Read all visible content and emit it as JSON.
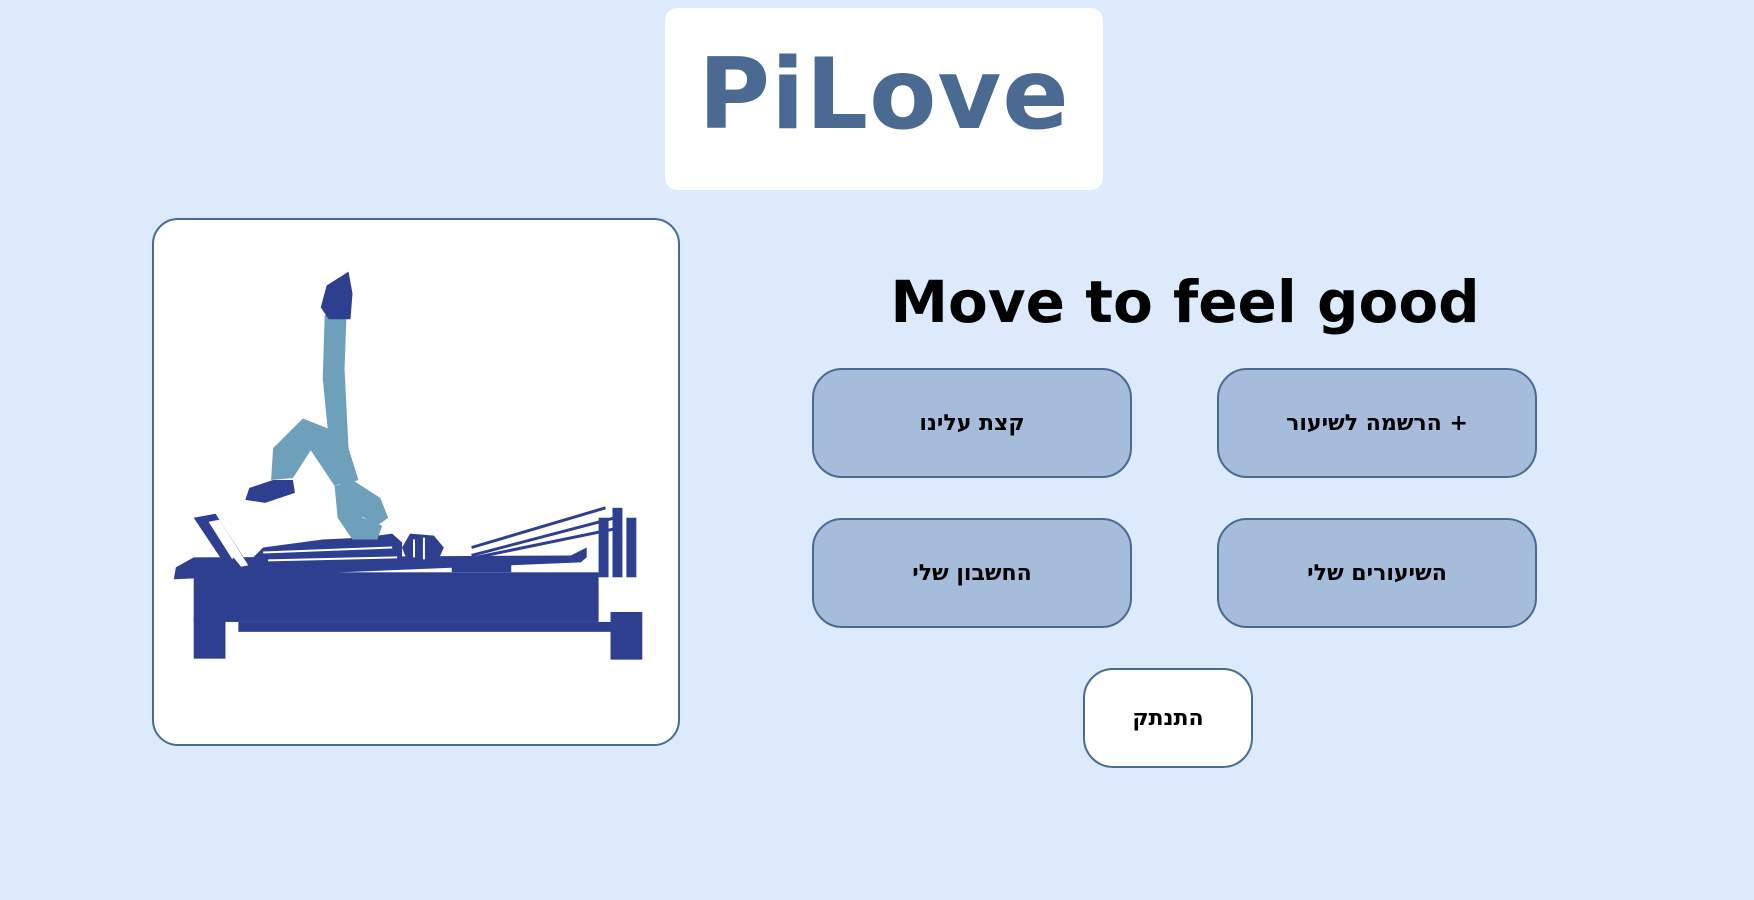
{
  "header": {
    "logo_text": "PiLove"
  },
  "hero_image": {
    "description_icon": "pilates-reformer-illustration",
    "colors": {
      "dark_blue": "#2e3f8f",
      "light_blue": "#6fa0bb"
    }
  },
  "main": {
    "tagline": "Move to feel good",
    "buttons": {
      "register": "+ הרשמה לשיעור",
      "about": "קצת עלינו",
      "my_lessons": "השיעורים שלי",
      "my_account": "החשבון שלי",
      "logout": "התנתק"
    }
  },
  "colors": {
    "background": "#dceafb",
    "accent": "#4a6a91",
    "button_fill": "#a6bcdb"
  }
}
